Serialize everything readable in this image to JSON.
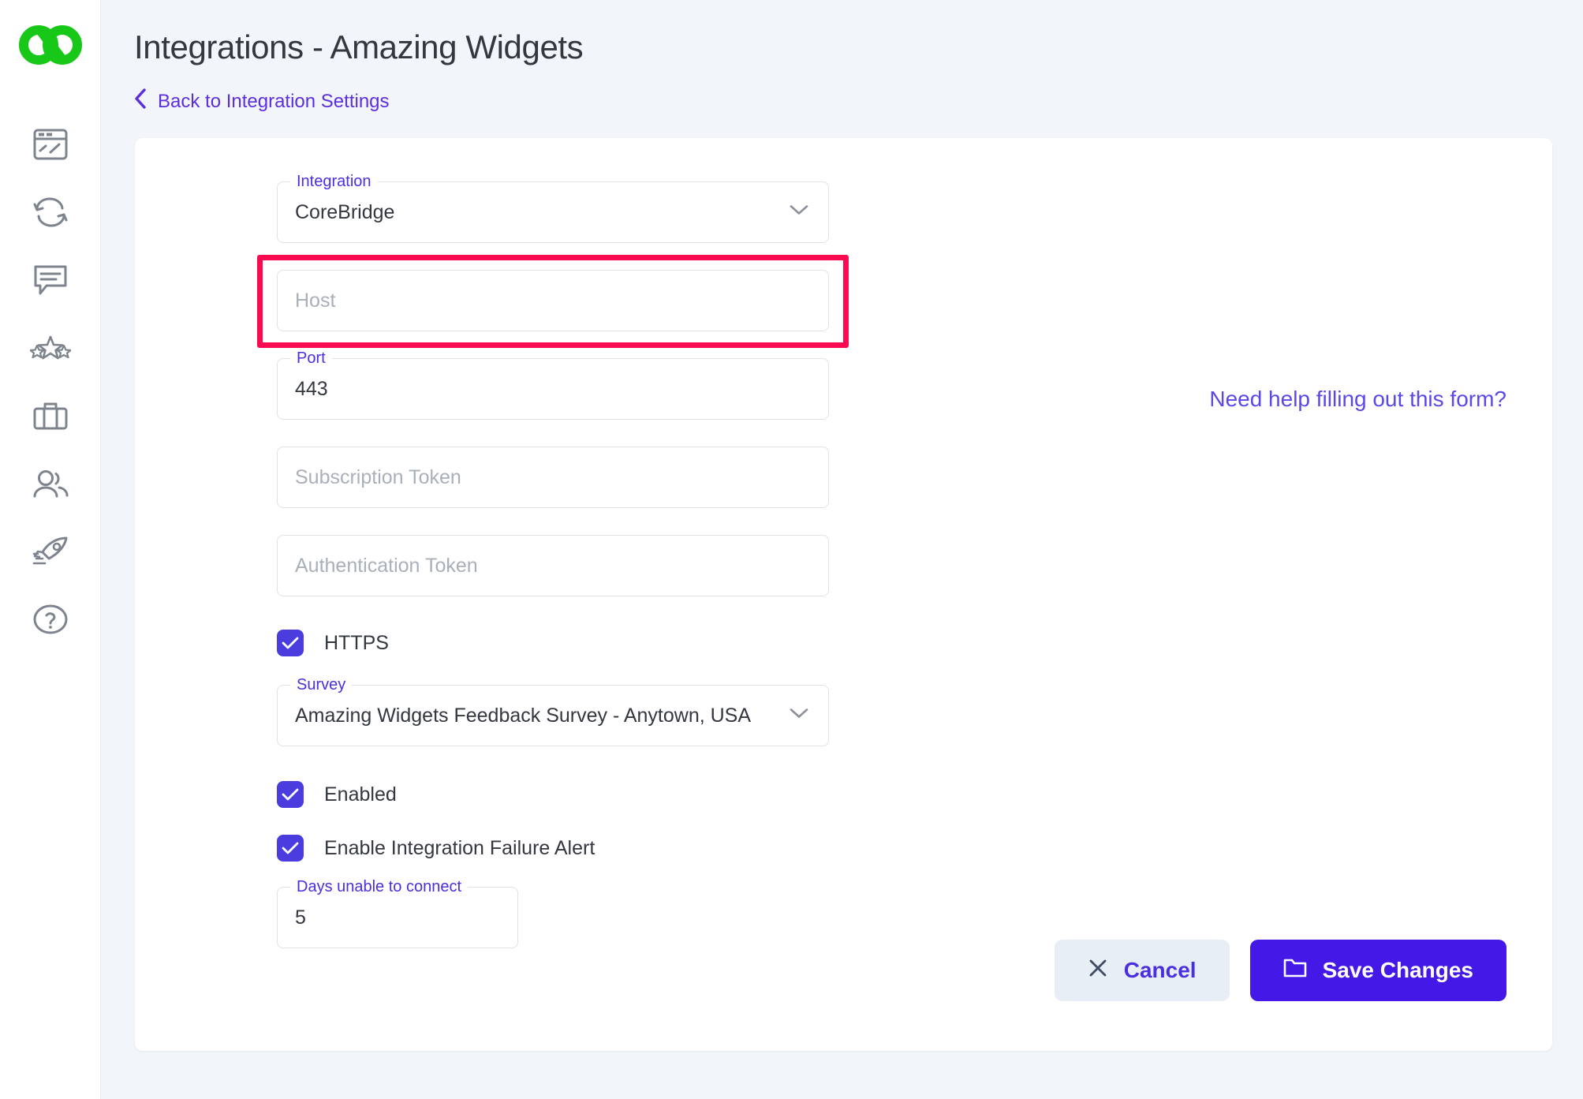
{
  "sidebar": {
    "logo_name": "interlocking-rings-logo",
    "logo_color": "#18c818",
    "items": [
      {
        "name": "dashboard-icon",
        "label": "Dashboard"
      },
      {
        "name": "sync-icon",
        "label": "Sync"
      },
      {
        "name": "feedback-icon",
        "label": "Feedback"
      },
      {
        "name": "reviews-stars-icon",
        "label": "Reviews"
      },
      {
        "name": "briefcase-icon",
        "label": "Business"
      },
      {
        "name": "users-icon",
        "label": "Users"
      },
      {
        "name": "rocket-icon",
        "label": "Launch"
      },
      {
        "name": "help-circle-icon",
        "label": "Help"
      }
    ]
  },
  "header": {
    "title": "Integrations - Amazing Widgets",
    "back_link": "Back to Integration Settings",
    "back_icon": "chevron-left-icon"
  },
  "form": {
    "integration": {
      "legend": "Integration",
      "value": "CoreBridge",
      "icon": "chevron-down-icon"
    },
    "host": {
      "placeholder": "Host",
      "value": "",
      "highlighted": true,
      "highlight_color": "#fa0a50"
    },
    "port": {
      "legend": "Port",
      "value": "443"
    },
    "subscription_token": {
      "placeholder": "Subscription Token",
      "value": ""
    },
    "authentication_token": {
      "placeholder": "Authentication Token",
      "value": ""
    },
    "https": {
      "label": "HTTPS",
      "checked": true
    },
    "survey": {
      "legend": "Survey",
      "value": "Amazing Widgets Feedback Survey - Anytown, USA",
      "icon": "chevron-down-icon"
    },
    "enabled": {
      "label": "Enabled",
      "checked": true
    },
    "failure_alert": {
      "label": "Enable Integration Failure Alert",
      "checked": true
    },
    "days_unable": {
      "legend": "Days unable to connect",
      "value": "5"
    }
  },
  "help": {
    "link_text": "Need help filling out this form?"
  },
  "footer": {
    "cancel_label": "Cancel",
    "cancel_icon": "close-x-icon",
    "save_label": "Save Changes",
    "save_icon": "folder-save-icon"
  },
  "colors": {
    "accent_purple": "#4b2ee0",
    "primary_button": "#4419e8",
    "checkbox": "#4b3ce0",
    "highlight_red": "#fa0a50",
    "page_background": "#f2f6fa",
    "logo_green": "#18c818"
  }
}
